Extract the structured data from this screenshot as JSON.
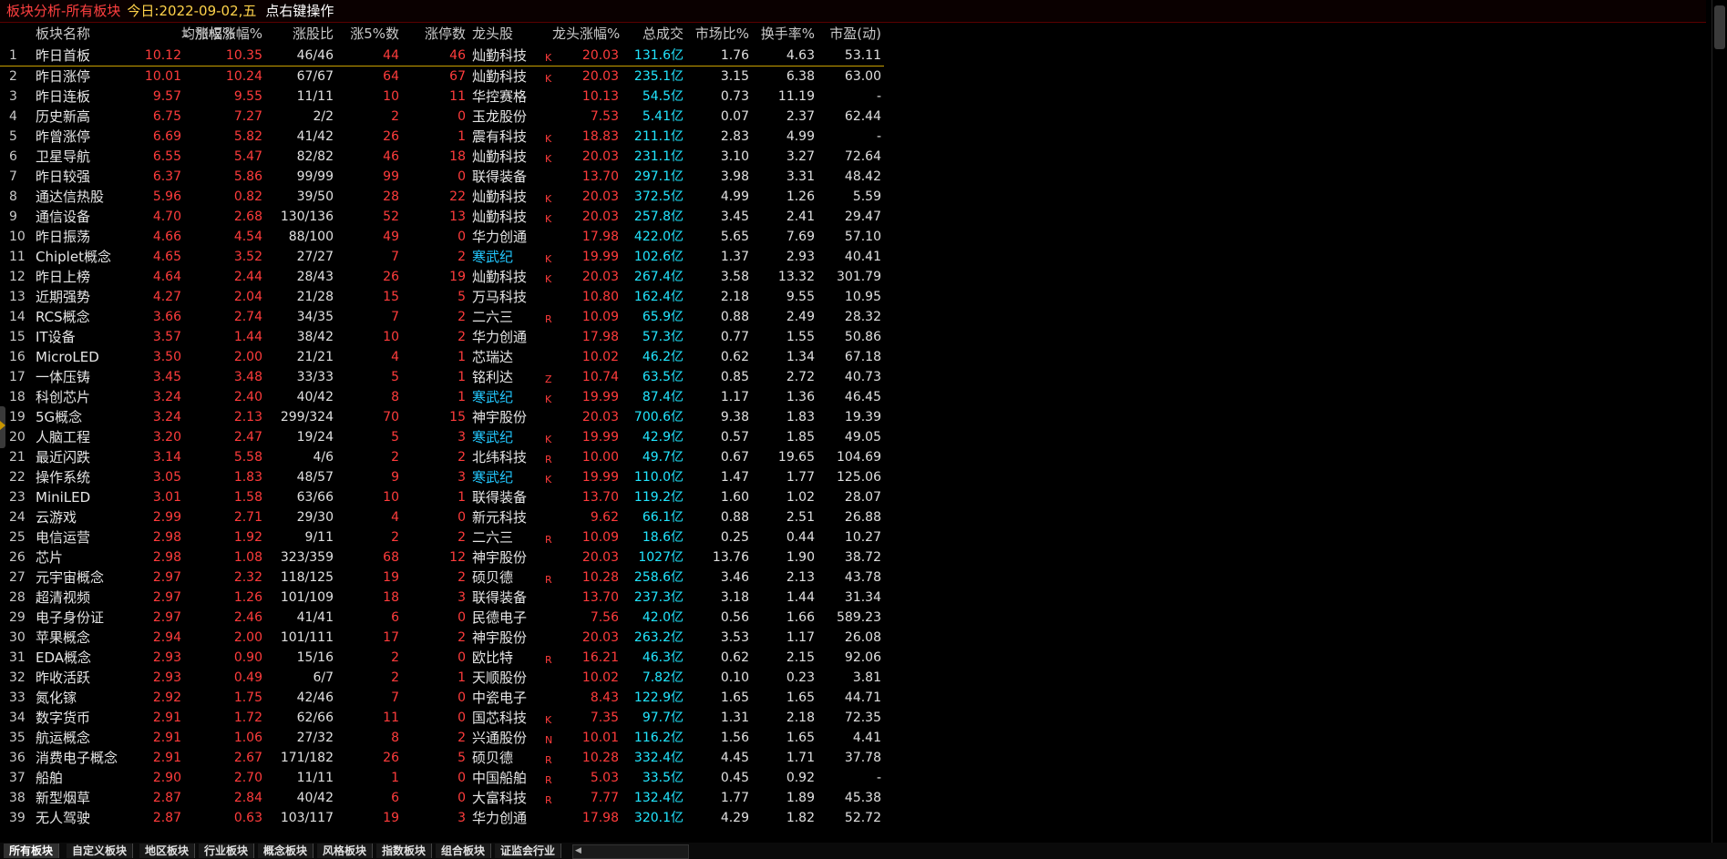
{
  "title": {
    "main": "板块分析-所有板块",
    "date": "今日:2022-09-02,五",
    "hint": "点右键操作"
  },
  "columns": {
    "name": "板块名称",
    "avg_change": "均涨幅%",
    "sort_indicator": "↓",
    "weighted_change": "加权涨幅%",
    "up_ratio": "涨股比",
    "up5": "涨5%数",
    "limit_up": "涨停数",
    "leader": "龙头股",
    "leader_change": "龙头涨幅%",
    "turnover": "总成交",
    "market_share": "市场比%",
    "turnover_rate": "换手率%",
    "pe": "市盈(动)"
  },
  "rows": [
    {
      "no": "1",
      "name": "昨日首板",
      "avg": "10.12",
      "wavg": "10.35",
      "ratio": "46/46",
      "up5": "44",
      "lim": "46",
      "leader": "灿勤科技",
      "cyan": false,
      "flag": "K",
      "lchg": "20.03",
      "amt": "131.6亿",
      "mkt": "1.76",
      "trate": "4.63",
      "pe": "53.11"
    },
    {
      "no": "2",
      "name": "昨日涨停",
      "avg": "10.01",
      "wavg": "10.24",
      "ratio": "67/67",
      "up5": "64",
      "lim": "67",
      "leader": "灿勤科技",
      "cyan": false,
      "flag": "K",
      "lchg": "20.03",
      "amt": "235.1亿",
      "mkt": "3.15",
      "trate": "6.38",
      "pe": "63.00"
    },
    {
      "no": "3",
      "name": "昨日连板",
      "avg": "9.57",
      "wavg": "9.55",
      "ratio": "11/11",
      "up5": "10",
      "lim": "11",
      "leader": "华控赛格",
      "cyan": false,
      "flag": "",
      "lchg": "10.13",
      "amt": "54.5亿",
      "mkt": "0.73",
      "trate": "11.19",
      "pe": "-"
    },
    {
      "no": "4",
      "name": "历史新高",
      "avg": "6.75",
      "wavg": "7.27",
      "ratio": "2/2",
      "up5": "2",
      "lim": "0",
      "leader": "玉龙股份",
      "cyan": false,
      "flag": "",
      "lchg": "7.53",
      "amt": "5.41亿",
      "mkt": "0.07",
      "trate": "2.37",
      "pe": "62.44"
    },
    {
      "no": "5",
      "name": "昨曾涨停",
      "avg": "6.69",
      "wavg": "5.82",
      "ratio": "41/42",
      "up5": "26",
      "lim": "1",
      "leader": "震有科技",
      "cyan": false,
      "flag": "K",
      "lchg": "18.83",
      "amt": "211.1亿",
      "mkt": "2.83",
      "trate": "4.99",
      "pe": "-"
    },
    {
      "no": "6",
      "name": "卫星导航",
      "avg": "6.55",
      "wavg": "5.47",
      "ratio": "82/82",
      "up5": "46",
      "lim": "18",
      "leader": "灿勤科技",
      "cyan": false,
      "flag": "K",
      "lchg": "20.03",
      "amt": "231.1亿",
      "mkt": "3.10",
      "trate": "3.27",
      "pe": "72.64"
    },
    {
      "no": "7",
      "name": "昨日较强",
      "avg": "6.37",
      "wavg": "5.86",
      "ratio": "99/99",
      "up5": "99",
      "lim": "0",
      "leader": "联得装备",
      "cyan": false,
      "flag": "",
      "lchg": "13.70",
      "amt": "297.1亿",
      "mkt": "3.98",
      "trate": "3.31",
      "pe": "48.42"
    },
    {
      "no": "8",
      "name": "通达信热股",
      "avg": "5.96",
      "wavg": "0.82",
      "ratio": "39/50",
      "up5": "28",
      "lim": "22",
      "leader": "灿勤科技",
      "cyan": false,
      "flag": "K",
      "lchg": "20.03",
      "amt": "372.5亿",
      "mkt": "4.99",
      "trate": "1.26",
      "pe": "5.59"
    },
    {
      "no": "9",
      "name": "通信设备",
      "avg": "4.70",
      "wavg": "2.68",
      "ratio": "130/136",
      "up5": "52",
      "lim": "13",
      "leader": "灿勤科技",
      "cyan": false,
      "flag": "K",
      "lchg": "20.03",
      "amt": "257.8亿",
      "mkt": "3.45",
      "trate": "2.41",
      "pe": "29.47"
    },
    {
      "no": "10",
      "name": "昨日振荡",
      "avg": "4.66",
      "wavg": "4.54",
      "ratio": "88/100",
      "up5": "49",
      "lim": "0",
      "leader": "华力创通",
      "cyan": false,
      "flag": "",
      "lchg": "17.98",
      "amt": "422.0亿",
      "mkt": "5.65",
      "trate": "7.69",
      "pe": "57.10"
    },
    {
      "no": "11",
      "name": "Chiplet概念",
      "avg": "4.65",
      "wavg": "3.52",
      "ratio": "27/27",
      "up5": "7",
      "lim": "2",
      "leader": "寒武纪",
      "cyan": true,
      "flag": "K",
      "lchg": "19.99",
      "amt": "102.6亿",
      "mkt": "1.37",
      "trate": "2.93",
      "pe": "40.41"
    },
    {
      "no": "12",
      "name": "昨日上榜",
      "avg": "4.64",
      "wavg": "2.44",
      "ratio": "28/43",
      "up5": "26",
      "lim": "19",
      "leader": "灿勤科技",
      "cyan": false,
      "flag": "K",
      "lchg": "20.03",
      "amt": "267.4亿",
      "mkt": "3.58",
      "trate": "13.32",
      "pe": "301.79"
    },
    {
      "no": "13",
      "name": "近期强势",
      "avg": "4.27",
      "wavg": "2.04",
      "ratio": "21/28",
      "up5": "15",
      "lim": "5",
      "leader": "万马科技",
      "cyan": false,
      "flag": "",
      "lchg": "10.80",
      "amt": "162.4亿",
      "mkt": "2.18",
      "trate": "9.55",
      "pe": "10.95"
    },
    {
      "no": "14",
      "name": "RCS概念",
      "avg": "3.66",
      "wavg": "2.74",
      "ratio": "34/35",
      "up5": "7",
      "lim": "2",
      "leader": "二六三",
      "cyan": false,
      "flag": "R",
      "lchg": "10.09",
      "amt": "65.9亿",
      "mkt": "0.88",
      "trate": "2.49",
      "pe": "28.32"
    },
    {
      "no": "15",
      "name": "IT设备",
      "avg": "3.57",
      "wavg": "1.44",
      "ratio": "38/42",
      "up5": "10",
      "lim": "2",
      "leader": "华力创通",
      "cyan": false,
      "flag": "",
      "lchg": "17.98",
      "amt": "57.3亿",
      "mkt": "0.77",
      "trate": "1.55",
      "pe": "50.86"
    },
    {
      "no": "16",
      "name": "MicroLED",
      "avg": "3.50",
      "wavg": "2.00",
      "ratio": "21/21",
      "up5": "4",
      "lim": "1",
      "leader": "芯瑞达",
      "cyan": false,
      "flag": "",
      "lchg": "10.02",
      "amt": "46.2亿",
      "mkt": "0.62",
      "trate": "1.34",
      "pe": "67.18"
    },
    {
      "no": "17",
      "name": "一体压铸",
      "avg": "3.45",
      "wavg": "3.48",
      "ratio": "33/33",
      "up5": "5",
      "lim": "1",
      "leader": "铭利达",
      "cyan": false,
      "flag": "Z",
      "lchg": "10.74",
      "amt": "63.5亿",
      "mkt": "0.85",
      "trate": "2.72",
      "pe": "40.73"
    },
    {
      "no": "18",
      "name": "科创芯片",
      "avg": "3.24",
      "wavg": "2.40",
      "ratio": "40/42",
      "up5": "8",
      "lim": "1",
      "leader": "寒武纪",
      "cyan": true,
      "flag": "K",
      "lchg": "19.99",
      "amt": "87.4亿",
      "mkt": "1.17",
      "trate": "1.36",
      "pe": "46.45"
    },
    {
      "no": "19",
      "name": "5G概念",
      "avg": "3.24",
      "wavg": "2.13",
      "ratio": "299/324",
      "up5": "70",
      "lim": "15",
      "leader": "神宇股份",
      "cyan": false,
      "flag": "",
      "lchg": "20.03",
      "amt": "700.6亿",
      "mkt": "9.38",
      "trate": "1.83",
      "pe": "19.39"
    },
    {
      "no": "20",
      "name": "人脑工程",
      "avg": "3.20",
      "wavg": "2.47",
      "ratio": "19/24",
      "up5": "5",
      "lim": "3",
      "leader": "寒武纪",
      "cyan": true,
      "flag": "K",
      "lchg": "19.99",
      "amt": "42.9亿",
      "mkt": "0.57",
      "trate": "1.85",
      "pe": "49.05"
    },
    {
      "no": "21",
      "name": "最近闪跌",
      "avg": "3.14",
      "wavg": "5.58",
      "ratio": "4/6",
      "up5": "2",
      "lim": "2",
      "leader": "北纬科技",
      "cyan": false,
      "flag": "R",
      "lchg": "10.00",
      "amt": "49.7亿",
      "mkt": "0.67",
      "trate": "19.65",
      "pe": "104.69"
    },
    {
      "no": "22",
      "name": "操作系统",
      "avg": "3.05",
      "wavg": "1.83",
      "ratio": "48/57",
      "up5": "9",
      "lim": "3",
      "leader": "寒武纪",
      "cyan": true,
      "flag": "K",
      "lchg": "19.99",
      "amt": "110.0亿",
      "mkt": "1.47",
      "trate": "1.77",
      "pe": "125.06"
    },
    {
      "no": "23",
      "name": "MiniLED",
      "avg": "3.01",
      "wavg": "1.58",
      "ratio": "63/66",
      "up5": "10",
      "lim": "1",
      "leader": "联得装备",
      "cyan": false,
      "flag": "",
      "lchg": "13.70",
      "amt": "119.2亿",
      "mkt": "1.60",
      "trate": "1.02",
      "pe": "28.07"
    },
    {
      "no": "24",
      "name": "云游戏",
      "avg": "2.99",
      "wavg": "2.71",
      "ratio": "29/30",
      "up5": "4",
      "lim": "0",
      "leader": "新元科技",
      "cyan": false,
      "flag": "",
      "lchg": "9.62",
      "amt": "66.1亿",
      "mkt": "0.88",
      "trate": "2.51",
      "pe": "26.88"
    },
    {
      "no": "25",
      "name": "电信运营",
      "avg": "2.98",
      "wavg": "1.92",
      "ratio": "9/11",
      "up5": "2",
      "lim": "2",
      "leader": "二六三",
      "cyan": false,
      "flag": "R",
      "lchg": "10.09",
      "amt": "18.6亿",
      "mkt": "0.25",
      "trate": "0.44",
      "pe": "10.27"
    },
    {
      "no": "26",
      "name": "芯片",
      "avg": "2.98",
      "wavg": "1.08",
      "ratio": "323/359",
      "up5": "68",
      "lim": "12",
      "leader": "神宇股份",
      "cyan": false,
      "flag": "",
      "lchg": "20.03",
      "amt": "1027亿",
      "mkt": "13.76",
      "trate": "1.90",
      "pe": "38.72"
    },
    {
      "no": "27",
      "name": "元宇宙概念",
      "avg": "2.97",
      "wavg": "2.32",
      "ratio": "118/125",
      "up5": "19",
      "lim": "2",
      "leader": "硕贝德",
      "cyan": false,
      "flag": "R",
      "lchg": "10.28",
      "amt": "258.6亿",
      "mkt": "3.46",
      "trate": "2.13",
      "pe": "43.78"
    },
    {
      "no": "28",
      "name": "超清视频",
      "avg": "2.97",
      "wavg": "1.26",
      "ratio": "101/109",
      "up5": "18",
      "lim": "3",
      "leader": "联得装备",
      "cyan": false,
      "flag": "",
      "lchg": "13.70",
      "amt": "237.3亿",
      "mkt": "3.18",
      "trate": "1.44",
      "pe": "31.34"
    },
    {
      "no": "29",
      "name": "电子身份证",
      "avg": "2.97",
      "wavg": "2.46",
      "ratio": "41/41",
      "up5": "6",
      "lim": "0",
      "leader": "民德电子",
      "cyan": false,
      "flag": "",
      "lchg": "7.56",
      "amt": "42.0亿",
      "mkt": "0.56",
      "trate": "1.66",
      "pe": "589.23"
    },
    {
      "no": "30",
      "name": "苹果概念",
      "avg": "2.94",
      "wavg": "2.00",
      "ratio": "101/111",
      "up5": "17",
      "lim": "2",
      "leader": "神宇股份",
      "cyan": false,
      "flag": "",
      "lchg": "20.03",
      "amt": "263.2亿",
      "mkt": "3.53",
      "trate": "1.17",
      "pe": "26.08"
    },
    {
      "no": "31",
      "name": "EDA概念",
      "avg": "2.93",
      "wavg": "0.90",
      "ratio": "15/16",
      "up5": "2",
      "lim": "0",
      "leader": "欧比特",
      "cyan": false,
      "flag": "R",
      "lchg": "16.21",
      "amt": "46.3亿",
      "mkt": "0.62",
      "trate": "2.15",
      "pe": "92.06"
    },
    {
      "no": "32",
      "name": "昨收活跃",
      "avg": "2.93",
      "wavg": "0.49",
      "ratio": "6/7",
      "up5": "2",
      "lim": "1",
      "leader": "天顺股份",
      "cyan": false,
      "flag": "",
      "lchg": "10.02",
      "amt": "7.82亿",
      "mkt": "0.10",
      "trate": "0.23",
      "pe": "3.81"
    },
    {
      "no": "33",
      "name": "氮化镓",
      "avg": "2.92",
      "wavg": "1.75",
      "ratio": "42/46",
      "up5": "7",
      "lim": "0",
      "leader": "中瓷电子",
      "cyan": false,
      "flag": "",
      "lchg": "8.43",
      "amt": "122.9亿",
      "mkt": "1.65",
      "trate": "1.65",
      "pe": "44.71"
    },
    {
      "no": "34",
      "name": "数字货币",
      "avg": "2.91",
      "wavg": "1.72",
      "ratio": "62/66",
      "up5": "11",
      "lim": "0",
      "leader": "国芯科技",
      "cyan": false,
      "flag": "K",
      "lchg": "7.35",
      "amt": "97.7亿",
      "mkt": "1.31",
      "trate": "2.18",
      "pe": "72.35"
    },
    {
      "no": "35",
      "name": "航运概念",
      "avg": "2.91",
      "wavg": "1.06",
      "ratio": "27/32",
      "up5": "8",
      "lim": "2",
      "leader": "兴通股份",
      "cyan": false,
      "flag": "N",
      "lchg": "10.01",
      "amt": "116.2亿",
      "mkt": "1.56",
      "trate": "1.65",
      "pe": "4.41"
    },
    {
      "no": "36",
      "name": "消费电子概念",
      "avg": "2.91",
      "wavg": "2.67",
      "ratio": "171/182",
      "up5": "26",
      "lim": "5",
      "leader": "硕贝德",
      "cyan": false,
      "flag": "R",
      "lchg": "10.28",
      "amt": "332.4亿",
      "mkt": "4.45",
      "trate": "1.71",
      "pe": "37.78"
    },
    {
      "no": "37",
      "name": "船舶",
      "avg": "2.90",
      "wavg": "2.70",
      "ratio": "11/11",
      "up5": "1",
      "lim": "0",
      "leader": "中国船舶",
      "cyan": false,
      "flag": "R",
      "lchg": "5.03",
      "amt": "33.5亿",
      "mkt": "0.45",
      "trate": "0.92",
      "pe": "-"
    },
    {
      "no": "38",
      "name": "新型烟草",
      "avg": "2.87",
      "wavg": "2.84",
      "ratio": "40/42",
      "up5": "6",
      "lim": "0",
      "leader": "大富科技",
      "cyan": false,
      "flag": "R",
      "lchg": "7.77",
      "amt": "132.4亿",
      "mkt": "1.77",
      "trate": "1.89",
      "pe": "45.38"
    },
    {
      "no": "39",
      "name": "无人驾驶",
      "avg": "2.87",
      "wavg": "0.63",
      "ratio": "103/117",
      "up5": "19",
      "lim": "3",
      "leader": "华力创通",
      "cyan": false,
      "flag": "",
      "lchg": "17.98",
      "amt": "320.1亿",
      "mkt": "4.29",
      "trate": "1.82",
      "pe": "52.72"
    }
  ],
  "tabs": [
    "所有板块",
    "自定义板块",
    "地区板块",
    "行业板块",
    "概念板块",
    "风格板块",
    "指数板块",
    "组合板块",
    "证监会行业"
  ]
}
